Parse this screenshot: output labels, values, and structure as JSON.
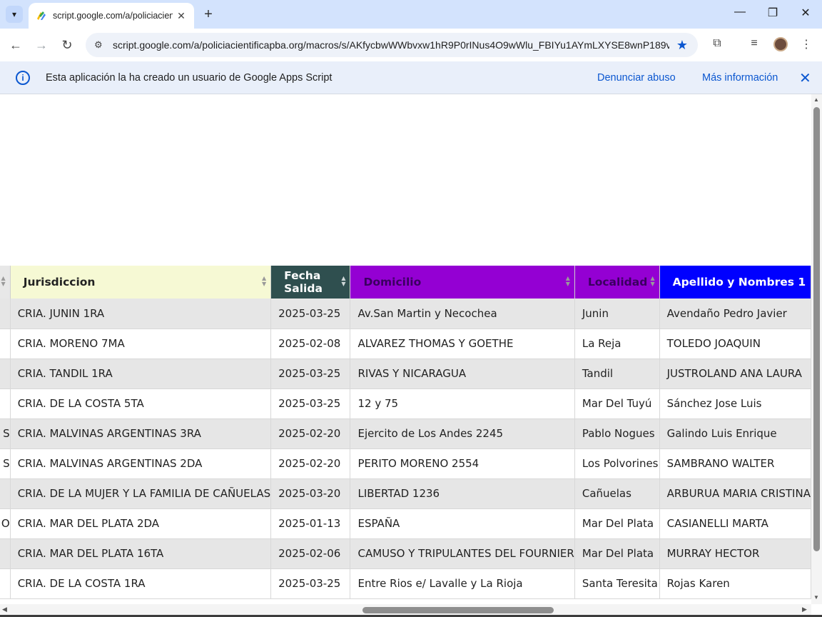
{
  "browser": {
    "tab_title": "script.google.com/a/policiacien",
    "url": "script.google.com/a/policiacientificapba.org/macros/s/AKfycbwWWbvxw1hR9P0rINus4O9wWlu_FBIYu1AYmLXYSE8wnP189vj...",
    "icons": {
      "tab_search": "▾",
      "tab_close": "✕",
      "new_tab": "+",
      "minimize": "—",
      "maximize": "❐",
      "window_close": "✕",
      "back": "←",
      "forward": "→",
      "reload": "↻",
      "site_info": "⚙",
      "bookmark_star": "★",
      "extensions": "⧉",
      "media": "≡",
      "menu": "⋮"
    }
  },
  "infobar": {
    "info_icon": "i",
    "message": "Esta aplicación la ha creado un usuario de Google Apps Script",
    "report_link": "Denunciar abuso",
    "more_info_link": "Más información",
    "close_icon": "✕"
  },
  "table": {
    "headers": [
      {
        "label": "",
        "bg": "#e8e8e8",
        "color": "#222"
      },
      {
        "label": "Jurisdiccion",
        "bg": "#f6f9d4",
        "color": "#222"
      },
      {
        "label": "Fecha Salida",
        "bg": "#2f4f4f",
        "color": "#ffffff"
      },
      {
        "label": "Domicilio",
        "bg": "#9400d3",
        "color": "#3a0060"
      },
      {
        "label": "Localidad",
        "bg": "#9400d3",
        "color": "#3a0060"
      },
      {
        "label": "Apellido y Nombres 1",
        "bg": "#0000ff",
        "color": "#ffffff"
      }
    ],
    "rows": [
      [
        "",
        "CRIA. JUNIN 1RA",
        "2025-03-25",
        "Av.San Martin y Necochea",
        "Junin",
        "Avendaño Pedro Javier"
      ],
      [
        "",
        "CRIA. MORENO 7MA",
        "2025-02-08",
        "ALVAREZ THOMAS Y GOETHE",
        "La Reja",
        "TOLEDO JOAQUIN"
      ],
      [
        "",
        "CRIA. TANDIL 1RA",
        "2025-03-25",
        "RIVAS Y NICARAGUA",
        "Tandil",
        "JUSTROLAND ANA LAURA"
      ],
      [
        "",
        "CRIA. DE LA COSTA 5TA",
        "2025-03-25",
        "12 y 75",
        "Mar Del Tuyú",
        "Sánchez Jose Luis"
      ],
      [
        "S",
        "CRIA. MALVINAS ARGENTINAS 3RA",
        "2025-02-20",
        "Ejercito de Los Andes 2245",
        "Pablo Nogues",
        "Galindo Luis Enrique"
      ],
      [
        "S",
        "CRIA. MALVINAS ARGENTINAS 2DA",
        "2025-02-20",
        "PERITO MORENO 2554",
        "Los Polvorines",
        "SAMBRANO WALTER"
      ],
      [
        "",
        "CRIA. DE LA MUJER Y LA FAMILIA DE CAÑUELAS",
        "2025-03-20",
        "LIBERTAD 1236",
        "Cañuelas",
        "ARBURUA MARIA CRISTINA"
      ],
      [
        "O",
        "CRIA. MAR DEL PLATA 2DA",
        "2025-01-13",
        "ESPAÑA",
        "Mar Del Plata",
        "CASIANELLI MARTA"
      ],
      [
        "",
        "CRIA. MAR DEL PLATA 16TA",
        "2025-02-06",
        "CAMUSO Y TRIPULANTES DEL FOURNIER",
        "Mar Del Plata",
        "MURRAY HECTOR"
      ],
      [
        "",
        "CRIA. DE LA COSTA 1RA",
        "2025-03-25",
        "Entre Rios e/ Lavalle y La Rioja",
        "Santa Teresita",
        "Rojas Karen"
      ]
    ]
  }
}
